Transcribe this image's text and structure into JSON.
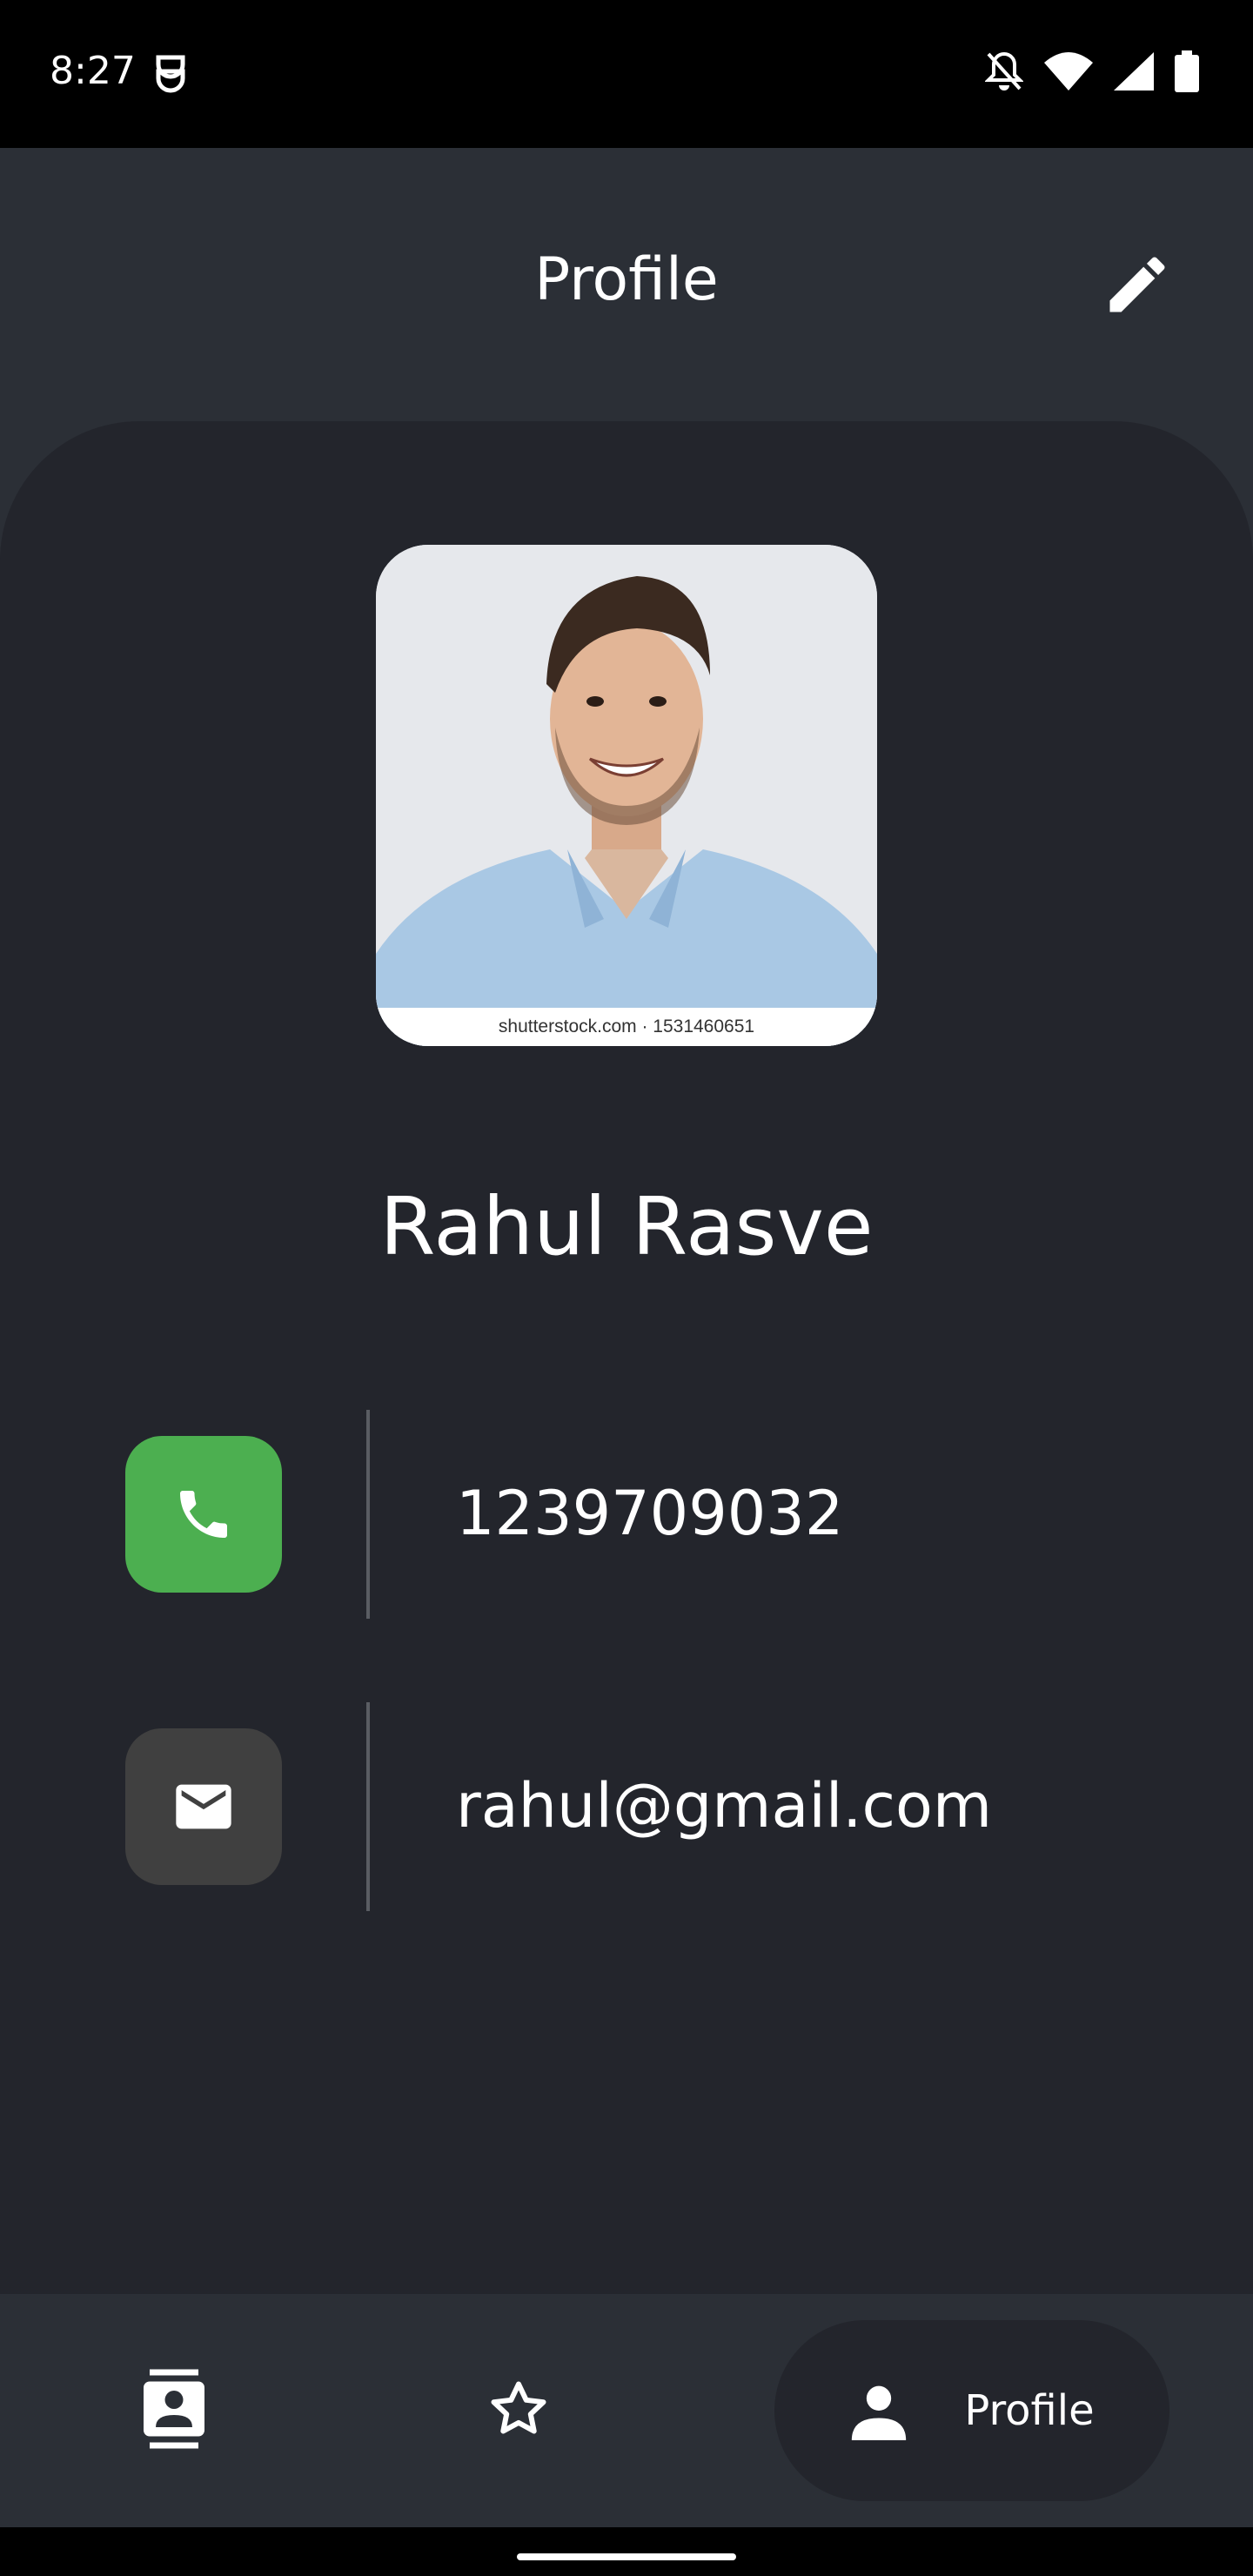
{
  "status_bar": {
    "time": "8:27",
    "icons": [
      "notification-app-icon",
      "do-not-disturb-icon",
      "wifi-icon",
      "cell-signal-icon",
      "battery-icon"
    ]
  },
  "app_bar": {
    "title": "Profile",
    "edit_icon": "pencil-icon"
  },
  "profile": {
    "photo_caption": "shutterstock.com · 1531460651",
    "name": "Rahul Rasve",
    "phone": "1239709032",
    "email": "rahul@gmail.com"
  },
  "colors": {
    "phone_icon_bg": "#4caf50",
    "email_icon_bg": "#404040",
    "surface": "#23252c",
    "app_bar": "#2b2f36"
  },
  "bottom_nav": {
    "items": [
      {
        "icon": "contacts-icon",
        "label": ""
      },
      {
        "icon": "star-icon",
        "label": ""
      },
      {
        "icon": "person-icon",
        "label": "Profile",
        "selected": true
      }
    ]
  }
}
